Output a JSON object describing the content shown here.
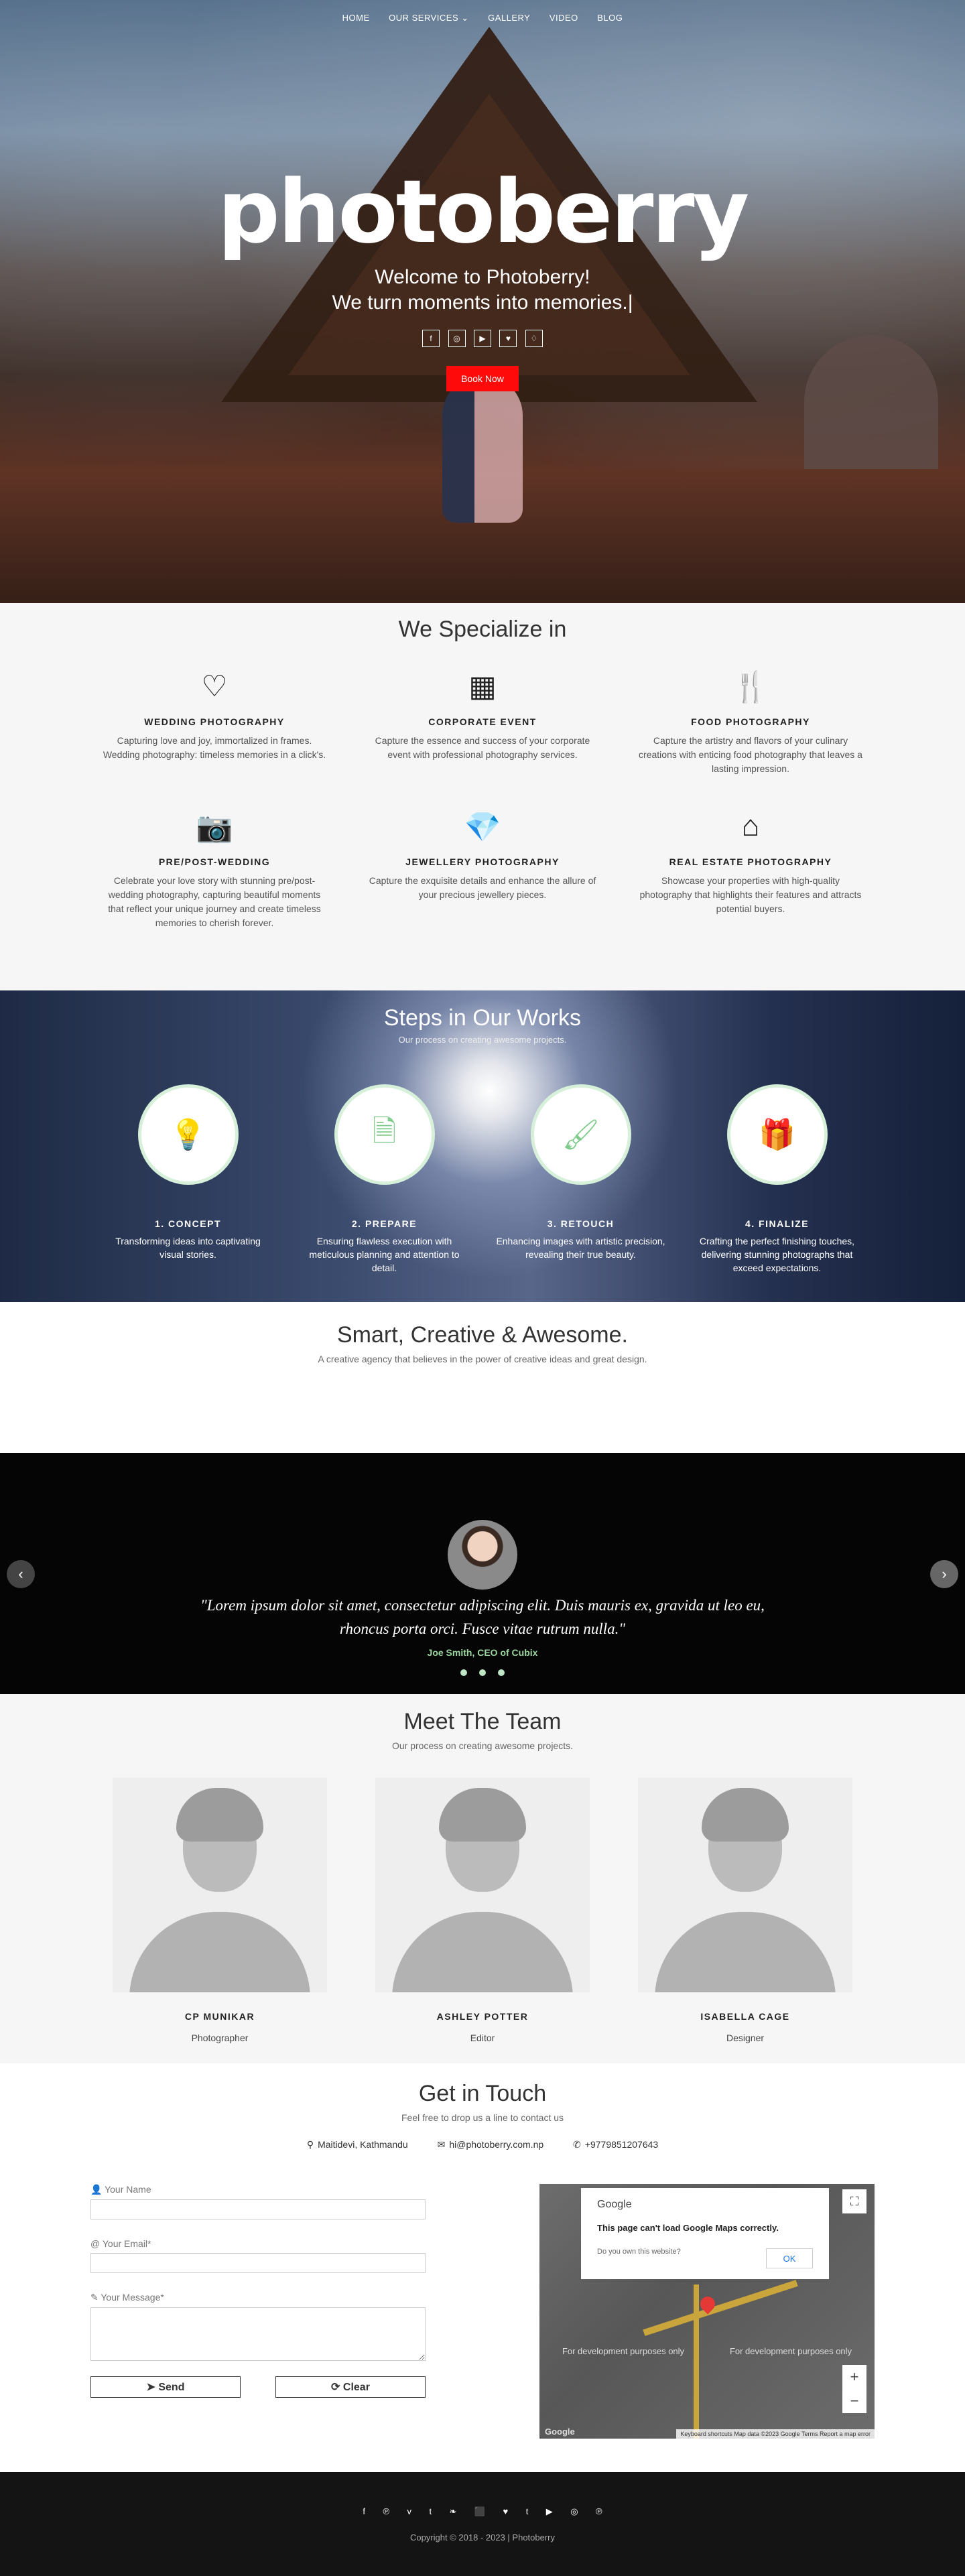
{
  "nav": {
    "items": [
      "HOME",
      "OUR SERVICES ⌄",
      "GALLERY",
      "VIDEO",
      "BLOG"
    ]
  },
  "hero": {
    "logo": "photoberry",
    "line1": "Welcome to Photoberry!",
    "line2": "We turn moments into memories.|",
    "book_label": "Book Now",
    "socials": [
      "f",
      "◎",
      "▶",
      "♥",
      "♢"
    ]
  },
  "specialize": {
    "title": "We Specialize in",
    "items": [
      {
        "icon": "heart-icon",
        "glyph": "♡",
        "title": "WEDDING PHOTOGRAPHY",
        "desc": "Capturing love and joy, immortalized in frames. Wedding photography: timeless memories in a click's."
      },
      {
        "icon": "building-icon",
        "glyph": "▦",
        "title": "CORPORATE EVENT",
        "desc": "Capture the essence and success of your corporate event with professional photography services."
      },
      {
        "icon": "cutlery-icon",
        "glyph": "🍴",
        "title": "FOOD PHOTOGRAPHY",
        "desc": "Capture the artistry and flavors of your culinary creations with enticing food photography that leaves a lasting impression."
      },
      {
        "icon": "camera-icon",
        "glyph": "📷",
        "title": "PRE/POST-WEDDING",
        "desc": "Celebrate your love story with stunning pre/post-wedding photography, capturing beautiful moments that reflect your unique journey and create timeless memories to cherish forever."
      },
      {
        "icon": "diamond-icon",
        "glyph": "💎",
        "title": "JEWELLERY PHOTOGRAPHY",
        "desc": "Capture the exquisite details and enhance the allure of your precious jewellery pieces."
      },
      {
        "icon": "home-icon",
        "glyph": "⌂",
        "title": "REAL ESTATE PHOTOGRAPHY",
        "desc": "Showcase your properties with high-quality photography that highlights their features and attracts potential buyers."
      }
    ]
  },
  "steps": {
    "title": "Steps in Our Works",
    "subtitle": "Our process on creating awesome projects.",
    "items": [
      {
        "icon": "lightbulb-icon",
        "glyph": "💡",
        "title": "1. CONCEPT",
        "desc": "Transforming ideas into captivating visual stories."
      },
      {
        "icon": "document-icon",
        "glyph": "🗎",
        "title": "2. PREPARE",
        "desc": "Ensuring flawless execution with meticulous planning and attention to detail."
      },
      {
        "icon": "brush-icon",
        "glyph": "🖌",
        "title": "3. RETOUCH",
        "desc": "Enhancing images with artistic precision, revealing their true beauty."
      },
      {
        "icon": "gift-icon",
        "glyph": "🎁",
        "title": "4. FINALIZE",
        "desc": "Crafting the perfect finishing touches, delivering stunning photographs that exceed expectations."
      }
    ]
  },
  "smart": {
    "title": "Smart, Creative & Awesome.",
    "subtitle": "A creative agency that believes in the power of creative ideas and great design."
  },
  "testimonial": {
    "quote": "\"Lorem ipsum dolor sit amet, consectetur adipiscing elit. Duis mauris ex, gravida ut leo eu, rhoncus porta orci. Fusce vitae rutrum nulla.\"",
    "author": "Joe Smith, CEO of Cubix",
    "prev": "‹",
    "next": "›"
  },
  "team": {
    "title": "Meet The Team",
    "subtitle": "Our process on creating awesome projects.",
    "members": [
      {
        "name": "CP MUNIKAR",
        "role": "Photographer"
      },
      {
        "name": "ASHLEY POTTER",
        "role": "Editor"
      },
      {
        "name": "ISABELLA CAGE",
        "role": "Designer"
      }
    ]
  },
  "contact": {
    "title": "Get in Touch",
    "subtitle": "Feel free to drop us a line to contact us",
    "address": "Maitidevi, Kathmandu",
    "email": "hi@photoberry.com.np",
    "phone": "+9779851207643",
    "name_label": "Your Name",
    "email_label": "Your Email*",
    "message_label": "Your Message*",
    "send_label": "Send",
    "clear_label": "Clear"
  },
  "map": {
    "brand": "Google",
    "message": "This page can't load Google Maps correctly.",
    "own": "Do you own this website?",
    "ok": "OK",
    "dev_left": "For development purposes only",
    "dev_right": "For development purposes only",
    "footer": "Keyboard shortcuts  Map data ©2023 Google  Terms  Report a map error",
    "logo": "Google",
    "zoom_in": "+",
    "zoom_out": "−"
  },
  "footer": {
    "socials": [
      "f",
      "℗",
      "v",
      "t",
      "❧",
      "⬛",
      "♥",
      "t",
      "▶",
      "◎",
      "℗"
    ],
    "copyright": "Copyright © 2018 - 2023 | Photoberry"
  },
  "colors": {
    "accent": "#ff0a0a",
    "green": "#7ecb8b",
    "dark": "#050505"
  }
}
